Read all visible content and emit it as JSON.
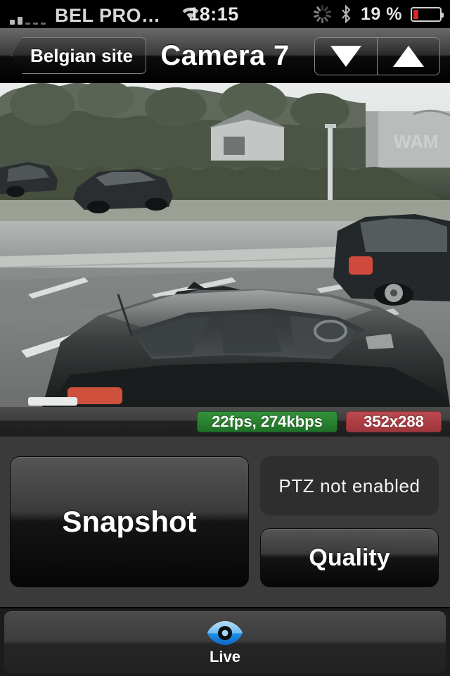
{
  "status_bar": {
    "carrier": "BEL PRO…",
    "signal_bars_filled": 2,
    "signal_bars_total": 5,
    "wifi_icon": "wifi-icon",
    "time": "18:15",
    "activity_icon": "activity-spinner-icon",
    "bluetooth_icon": "bluetooth-icon",
    "battery_percent": "19 %",
    "battery_level": 19,
    "battery_color": "#d7262c"
  },
  "nav_bar": {
    "back_label": "Belgian site",
    "title": "Camera 7",
    "prev_icon": "triangle-down-icon",
    "next_icon": "triangle-up-icon"
  },
  "video": {
    "alt": "live-camera-parking-lot-view"
  },
  "stream_status": {
    "rate_badge": "22fps, 274kbps",
    "rate_badge_color": "#2a8130",
    "resolution_badge": "352x288",
    "resolution_badge_color": "#ad3f45"
  },
  "controls": {
    "snapshot_label": "Snapshot",
    "ptz_label": "PTZ not enabled",
    "quality_label": "Quality"
  },
  "tab_bar": {
    "tabs": [
      {
        "label": "Live",
        "icon": "eye-icon",
        "selected": true
      }
    ]
  }
}
